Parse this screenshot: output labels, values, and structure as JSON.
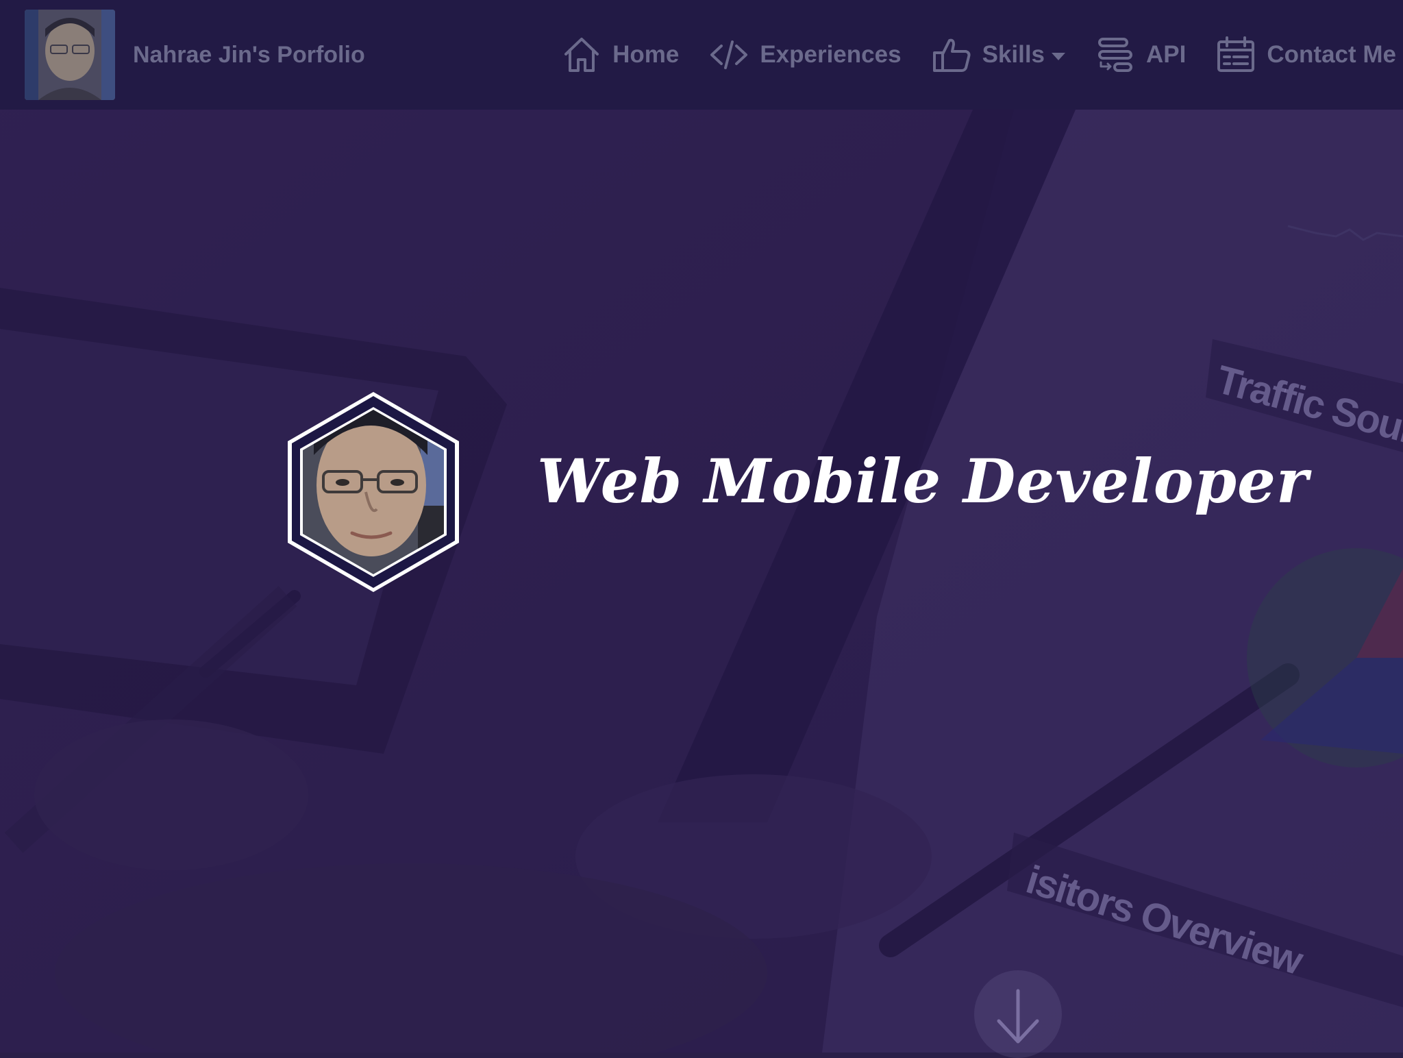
{
  "navbar": {
    "brand_title": "Nahrae Jin's Porfolio",
    "items": [
      {
        "label": "Home",
        "icon": "home-icon"
      },
      {
        "label": "Experiences",
        "icon": "code-icon"
      },
      {
        "label": "Skills",
        "icon": "thumbs-up-icon",
        "has_dropdown": true
      },
      {
        "label": "API",
        "icon": "api-icon"
      },
      {
        "label": "Contact Me",
        "icon": "calendar-icon"
      }
    ]
  },
  "hero": {
    "title": "Web Mobile Developer",
    "avatar_icon": "profile-photo"
  },
  "background": {
    "traffic_label": "Traffic Sources",
    "visitors_label": "isitors Overview"
  },
  "scroll_button": {
    "icon": "arrow-down-icon"
  },
  "colors": {
    "navbar_bg": "#221a45",
    "nav_text": "#6b6a8c",
    "hero_text": "#ffffff",
    "page_bg": "#2a1f48"
  }
}
